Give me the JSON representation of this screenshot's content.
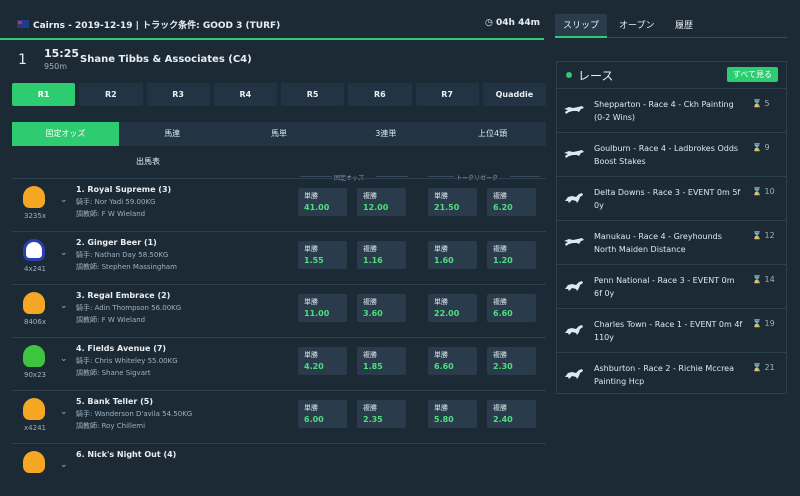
{
  "header": {
    "title": "Cairns - 2019-12-19 | トラック条件: GOOD 3 (TURF)",
    "countdown": "04h 44m"
  },
  "race": {
    "number": "1",
    "time": "15:25",
    "distance": "950m",
    "name": "Shane Tibbs & Associates (C4)"
  },
  "race_tabs": [
    "R1",
    "R2",
    "R3",
    "R4",
    "R5",
    "R6",
    "R7",
    "Quaddie"
  ],
  "bet_tabs": [
    "固定オッズ",
    "馬連",
    "馬単",
    "3連単",
    "上位4頭"
  ],
  "subtab": "出馬表",
  "columns": {
    "fixed": "固定オッズ",
    "tote": "トータリゼータ"
  },
  "runners": [
    {
      "name": "1. Royal Supreme (3)",
      "jockey": "騎手: Nor Yadi 59.00KG",
      "trainer": "調教師: F W Wieland",
      "code": "3235x",
      "silk": "#f5a623",
      "odds": [
        {
          "label": "単勝",
          "value": "41.00"
        },
        {
          "label": "複勝",
          "value": "12.00"
        },
        {
          "label": "単勝",
          "value": "21.50"
        },
        {
          "label": "複勝",
          "value": "6.20"
        }
      ]
    },
    {
      "name": "2. Ginger Beer (1)",
      "jockey": "騎手: Nathan Day 58.50KG",
      "trainer": "調教師: Stephen Massingham",
      "code": "4x241",
      "silk": "#ffffff",
      "odds": [
        {
          "label": "単勝",
          "value": "1.55"
        },
        {
          "label": "複勝",
          "value": "1.16"
        },
        {
          "label": "単勝",
          "value": "1.60"
        },
        {
          "label": "複勝",
          "value": "1.20"
        }
      ]
    },
    {
      "name": "3. Regal Embrace (2)",
      "jockey": "騎手: Adin Thompson 56.00KG",
      "trainer": "調教師: F W Wieland",
      "code": "8406x",
      "silk": "#f5a623",
      "odds": [
        {
          "label": "単勝",
          "value": "11.00"
        },
        {
          "label": "複勝",
          "value": "3.60"
        },
        {
          "label": "単勝",
          "value": "22.00"
        },
        {
          "label": "複勝",
          "value": "6.60"
        }
      ]
    },
    {
      "name": "4. Fields Avenue (7)",
      "jockey": "騎手: Chris Whiteley 55.00KG",
      "trainer": "調教師: Shane Sigvart",
      "code": "90x23",
      "silk": "#3ec43e",
      "odds": [
        {
          "label": "単勝",
          "value": "4.20"
        },
        {
          "label": "複勝",
          "value": "1.85"
        },
        {
          "label": "単勝",
          "value": "6.60"
        },
        {
          "label": "複勝",
          "value": "2.30"
        }
      ]
    },
    {
      "name": "5. Bank Teller (5)",
      "jockey": "騎手: Wanderson D'avila 54.50KG",
      "trainer": "調教師: Roy Chillemi",
      "code": "x4241",
      "silk": "#f5a623",
      "odds": [
        {
          "label": "単勝",
          "value": "6.00"
        },
        {
          "label": "複勝",
          "value": "2.35"
        },
        {
          "label": "単勝",
          "value": "5.80"
        },
        {
          "label": "複勝",
          "value": "2.40"
        }
      ]
    },
    {
      "name": "6. Nick's Night Out (4)",
      "jockey": "",
      "trainer": "",
      "code": "",
      "silk": "#f5a623",
      "odds": []
    }
  ],
  "slip_tabs": [
    "スリップ",
    "オープン",
    "履歴"
  ],
  "races_panel": {
    "title": "レース",
    "see_all": "すべて見る"
  },
  "next_races": [
    {
      "text": "Shepparton - Race 4 - Ckh Painting (0-2 Wins)",
      "count": "5",
      "icon": "greyhound-icon"
    },
    {
      "text": "Goulburn - Race 4 - Ladbrokes Odds Boost Stakes",
      "count": "9",
      "icon": "greyhound-icon"
    },
    {
      "text": "Delta Downs - Race 3 - EVENT 0m 5f 0y",
      "count": "10",
      "icon": "horse-icon"
    },
    {
      "text": "Manukau - Race 4 - Greyhounds North Maiden Distance",
      "count": "12",
      "icon": "greyhound-icon"
    },
    {
      "text": "Penn National - Race 3 - EVENT 0m 6f 0y",
      "count": "14",
      "icon": "horse-icon"
    },
    {
      "text": "Charles Town - Race 1 - EVENT 0m 4f 110y",
      "count": "19",
      "icon": "horse-icon"
    },
    {
      "text": "Ashburton - Race 2 - Richie Mccrea Painting Hcp",
      "count": "21",
      "icon": "horse-icon"
    }
  ],
  "colors": {
    "accent": "#2ecc71",
    "background": "#1c2a36",
    "odds": "#4be07d"
  }
}
